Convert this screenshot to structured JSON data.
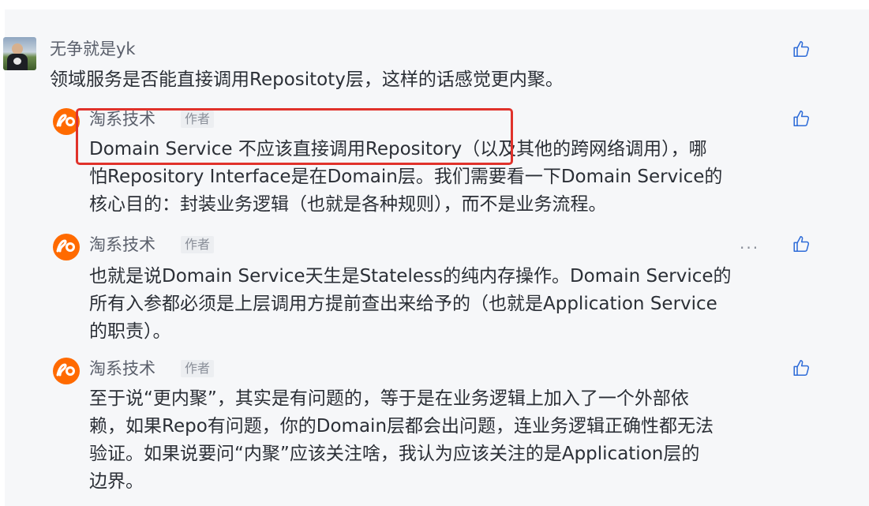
{
  "comment_main": {
    "author": "无争就是yk",
    "text": "领域服务是否能直接调用Repositoty层，这样的话感觉更内聚。"
  },
  "replies": [
    {
      "author": "淘系技术",
      "badge": "作者",
      "lines": [
        "Domain Service 不应该直接调用Repository（以及其他的跨网络调用），哪",
        "怕Repository Interface是在Domain层。我们需要看一下Domain Service的",
        "核心目的：封装业务逻辑（也就是各种规则），而不是业务流程。"
      ]
    },
    {
      "author": "淘系技术",
      "badge": "作者",
      "more": "···",
      "lines": [
        "也就是说Domain Service天生是Stateless的纯内存操作。Domain Service的",
        "所有入参都必须是上层调用方提前查出来给予的（也就是Application Service",
        "的职责）。"
      ]
    },
    {
      "author": "淘系技术",
      "badge": "作者",
      "lines": [
        "至于说“更内聚”，其实是有问题的，等于是在业务逻辑上加入了一个外部依",
        "赖，如果Repo有问题，你的Domain层都会出问题，连业务逻辑正确性都无法",
        "验证。如果说要问“内聚”应该关注啥，我认为应该关注的是Application层的",
        "边界。"
      ]
    }
  ],
  "icons": {
    "like": "thumbs-up-icon",
    "avatar": "taobao-logo-icon",
    "more": "more-options-icon"
  },
  "colors": {
    "highlight": "#e0322b",
    "taobao_orange": "#ff6a00"
  }
}
